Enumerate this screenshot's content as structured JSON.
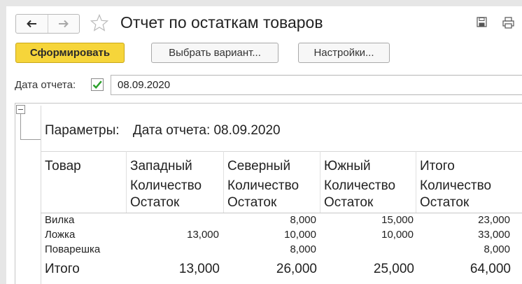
{
  "window": {
    "title": "Отчет по остаткам товаров"
  },
  "toolbar": {
    "generate_label": "Сформировать",
    "variant_label": "Выбрать вариант...",
    "settings_label": "Настройки..."
  },
  "filters": {
    "date_label": "Дата отчета:",
    "date_checked": true,
    "date_value": "08.09.2020"
  },
  "report": {
    "params_label": "Параметры:",
    "params_value": "Дата отчета: 08.09.2020",
    "columns": [
      {
        "header": "Товар",
        "sub1": "",
        "sub2": ""
      },
      {
        "header": "Западный",
        "sub1": "Количество",
        "sub2": "Остаток"
      },
      {
        "header": "Северный",
        "sub1": "Количество",
        "sub2": "Остаток"
      },
      {
        "header": "Южный",
        "sub1": "Количество",
        "sub2": "Остаток"
      },
      {
        "header": "Итого",
        "sub1": "Количество",
        "sub2": "Остаток"
      }
    ],
    "rows": [
      {
        "name": "Вилка",
        "west": "",
        "north": "8,000",
        "south": "15,000",
        "total": "23,000"
      },
      {
        "name": "Ложка",
        "west": "13,000",
        "north": "10,000",
        "south": "10,000",
        "total": "33,000"
      },
      {
        "name": "Поварешка",
        "west": "",
        "north": "8,000",
        "south": "",
        "total": "8,000"
      }
    ],
    "totals": {
      "name": "Итого",
      "west": "13,000",
      "north": "26,000",
      "south": "25,000",
      "total": "64,000"
    }
  },
  "icons": {
    "back": "arrow-left-icon",
    "forward": "arrow-right-icon",
    "favorite": "star-icon",
    "save": "save-icon",
    "print": "print-icon",
    "checkbox": "checkmark-icon",
    "collapse": "collapse-icon"
  },
  "colors": {
    "primary_button": "#f6d53a",
    "checkmark": "#2aa02a",
    "frame": "#e6e6e6"
  }
}
